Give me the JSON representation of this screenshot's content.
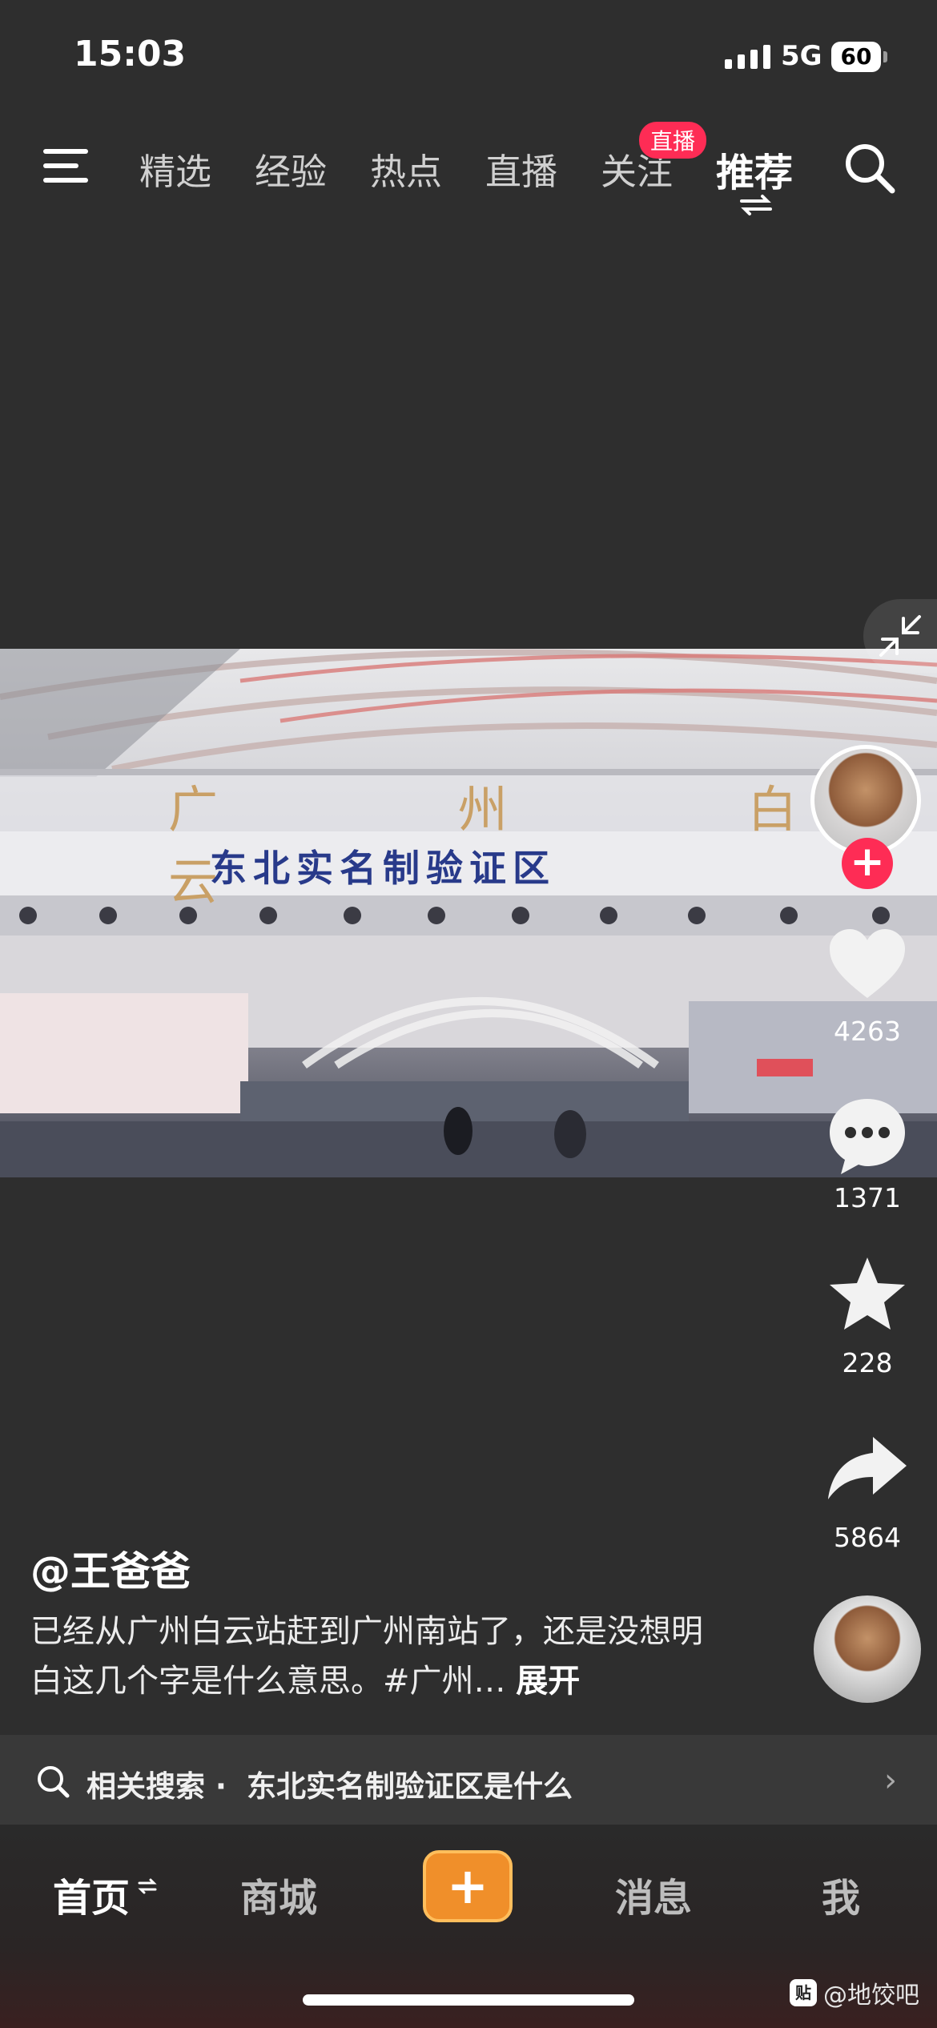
{
  "status_bar": {
    "time": "15:03",
    "network": "5G",
    "battery": "60"
  },
  "top_tabs": [
    {
      "label": "精选"
    },
    {
      "label": "经验"
    },
    {
      "label": "热点"
    },
    {
      "label": "直播"
    },
    {
      "label": "关注",
      "badge": "直播"
    },
    {
      "label": "推荐",
      "active": true
    }
  ],
  "video": {
    "scene": {
      "sign_main": "东北实名制验证区",
      "sign_top": "广 州 白 云"
    }
  },
  "actions": {
    "likes": "4263",
    "comments": "1371",
    "favorites": "228",
    "shares": "5864"
  },
  "post": {
    "author": "@王爸爸",
    "caption": "已经从广州白云站赶到广州南站了，还是没想明白这几个字是什么意思。#广州…",
    "expand_label": "展开"
  },
  "related_search": {
    "label": "相关搜索 ·",
    "query": "东北实名制验证区是什么"
  },
  "bottom_nav": {
    "home": "首页",
    "shop": "商城",
    "publish": "+",
    "messages": "消息",
    "me": "我"
  },
  "watermark": {
    "icon": "贴",
    "text": "@地饺吧"
  },
  "colors": {
    "accent": "#fe2c55",
    "publish": "#f08f2a",
    "background": "#2e2e2e"
  }
}
